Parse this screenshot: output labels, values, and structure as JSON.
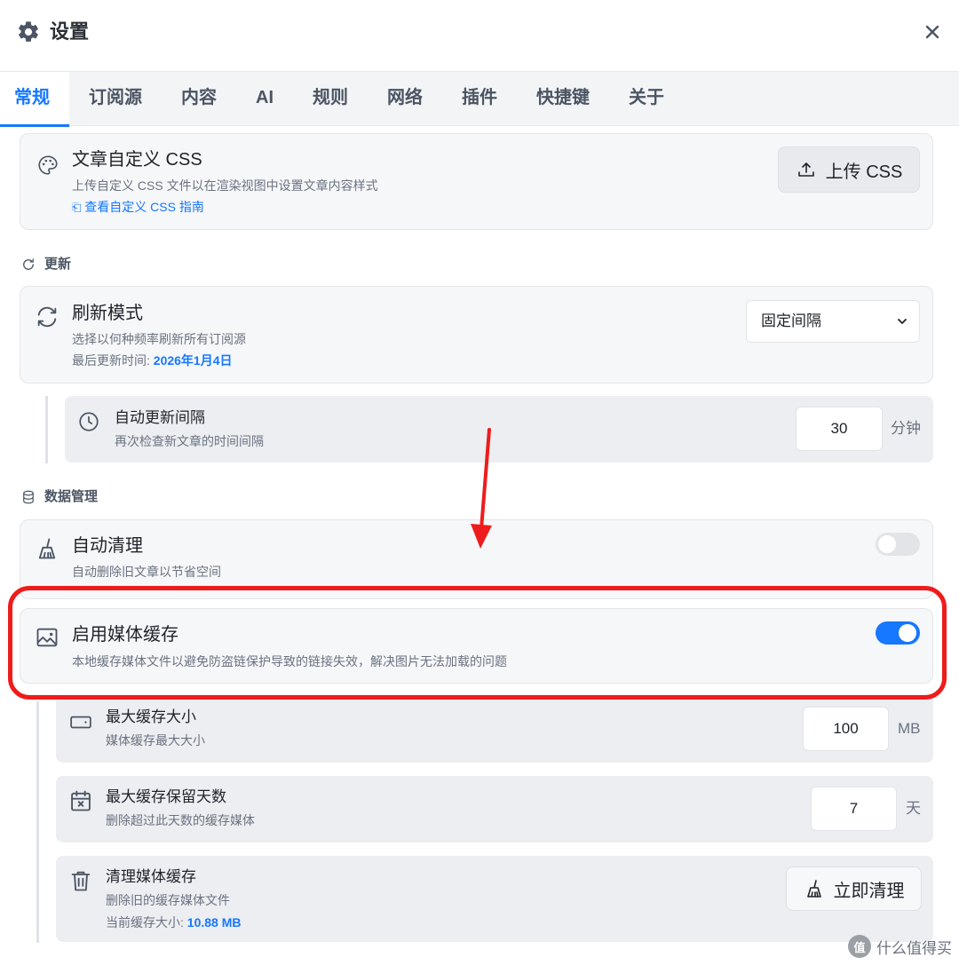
{
  "window": {
    "title": "设置"
  },
  "tabs": [
    "常规",
    "订阅源",
    "内容",
    "AI",
    "规则",
    "网络",
    "插件",
    "快捷键",
    "关于"
  ],
  "custom_css": {
    "title": "文章自定义 CSS",
    "desc": "上传自定义 CSS 文件以在渲染视图中设置文章内容样式",
    "guide_link": "查看自定义 CSS 指南",
    "upload_button": "上传 CSS"
  },
  "update_section": {
    "label": "更新",
    "refresh": {
      "title": "刷新模式",
      "desc": "选择以何种频率刷新所有订阅源",
      "last_update_label": "最后更新时间:",
      "last_update_value": "2026年1月4日",
      "select_value": "固定间隔"
    },
    "interval": {
      "title": "自动更新间隔",
      "desc": "再次检查新文章的时间间隔",
      "value": "30",
      "unit": "分钟"
    }
  },
  "data_section": {
    "label": "数据管理",
    "auto_clean": {
      "title": "自动清理",
      "desc": "自动删除旧文章以节省空间",
      "enabled": false
    },
    "media_cache": {
      "title": "启用媒体缓存",
      "desc": "本地缓存媒体文件以避免防盗链保护导致的链接失效，解决图片无法加载的问题",
      "enabled": true
    },
    "max_cache_size": {
      "title": "最大缓存大小",
      "desc": "媒体缓存最大大小",
      "value": "100",
      "unit": "MB"
    },
    "max_cache_days": {
      "title": "最大缓存保留天数",
      "desc": "删除超过此天数的缓存媒体",
      "value": "7",
      "unit": "天"
    },
    "clear_cache": {
      "title": "清理媒体缓存",
      "desc": "删除旧的缓存媒体文件",
      "size_label": "当前缓存大小:",
      "size_value": "10.88 MB",
      "button": "立即清理"
    }
  },
  "watermark": {
    "text": "什么值得买",
    "logo": "值"
  },
  "colors": {
    "accent": "#1677ff",
    "highlight": "#ee1c1c"
  }
}
